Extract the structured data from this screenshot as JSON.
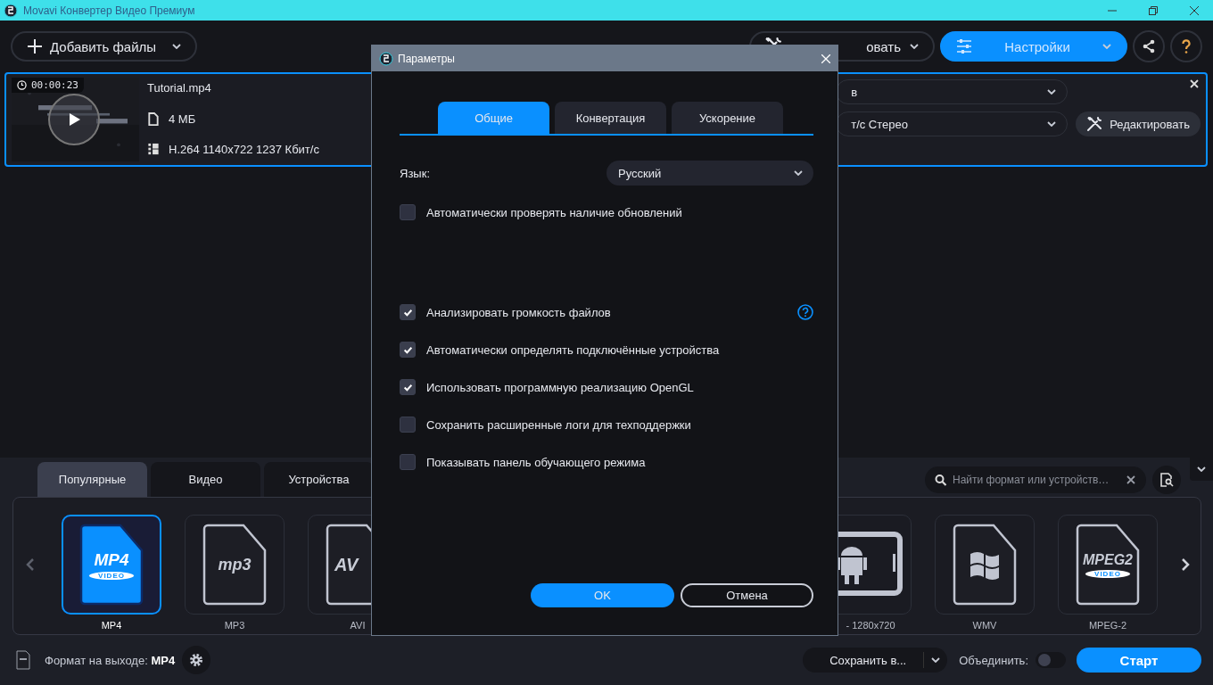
{
  "window": {
    "title": "Movavi Конвертер Видео Премиум"
  },
  "toolbar": {
    "add_files": "Добавить файлы",
    "convert": "овать",
    "settings": "Настройки"
  },
  "file": {
    "duration": "00:00:23",
    "name": "Tutorial.mp4",
    "size": "4 МБ",
    "codec": "H.264 1140x722 1237 Кбит/с",
    "video_output": "в",
    "audio_output": "т/с Стерео",
    "edit": "Редактировать"
  },
  "format_tabs": [
    {
      "label": "Популярные",
      "selected": true
    },
    {
      "label": "Видео",
      "selected": false
    },
    {
      "label": "Устройства",
      "selected": false
    }
  ],
  "search": {
    "placeholder": "Найти формат или устройств…"
  },
  "formats_left": [
    {
      "kind": "mp4",
      "label": "MP4",
      "badge": "MP4",
      "sub": "VIDEO",
      "selected": true
    },
    {
      "kind": "mp3",
      "label": "MP3",
      "badge": "mp3",
      "selected": false
    },
    {
      "kind": "avi",
      "label": "AVI",
      "badge": "AV",
      "selected": false
    }
  ],
  "formats_right": [
    {
      "kind": "device",
      "label": "- 1280x720",
      "selected": false
    },
    {
      "kind": "windows",
      "label": "WMV",
      "selected": false
    },
    {
      "kind": "mpeg2",
      "label": "MPEG-2",
      "badge": "MPEG2",
      "sub": "VIDEO",
      "selected": false
    }
  ],
  "footer": {
    "output_format": "Формат на выходе: **MP4**",
    "save_to": "Сохранить в...",
    "join_label": "Объединить:",
    "join_on": false,
    "start": "Старт"
  },
  "dialog": {
    "title": "Параметры",
    "tabs": [
      {
        "label": "Общие",
        "selected": true
      },
      {
        "label": "Конвертация",
        "selected": false
      },
      {
        "label": "Ускорение",
        "selected": false
      }
    ],
    "language_label": "Язык:",
    "language": "Русский",
    "update_option": {
      "label": "Автоматически проверять наличие обновлений",
      "checked": false
    },
    "options": [
      {
        "label": "Анализировать громкость файлов",
        "checked": true,
        "help": true
      },
      {
        "label": "Автоматически определять подключённые устройства",
        "checked": true,
        "help": false
      },
      {
        "label": "Использовать программную реализацию OpenGL",
        "checked": true,
        "help": false
      },
      {
        "label": "Сохранить расширенные логи для техподдержки",
        "checked": false,
        "help": false
      },
      {
        "label": "Показывать панель обучающего режима",
        "checked": false,
        "help": false
      }
    ],
    "ok": "OK",
    "cancel": "Отмена"
  }
}
